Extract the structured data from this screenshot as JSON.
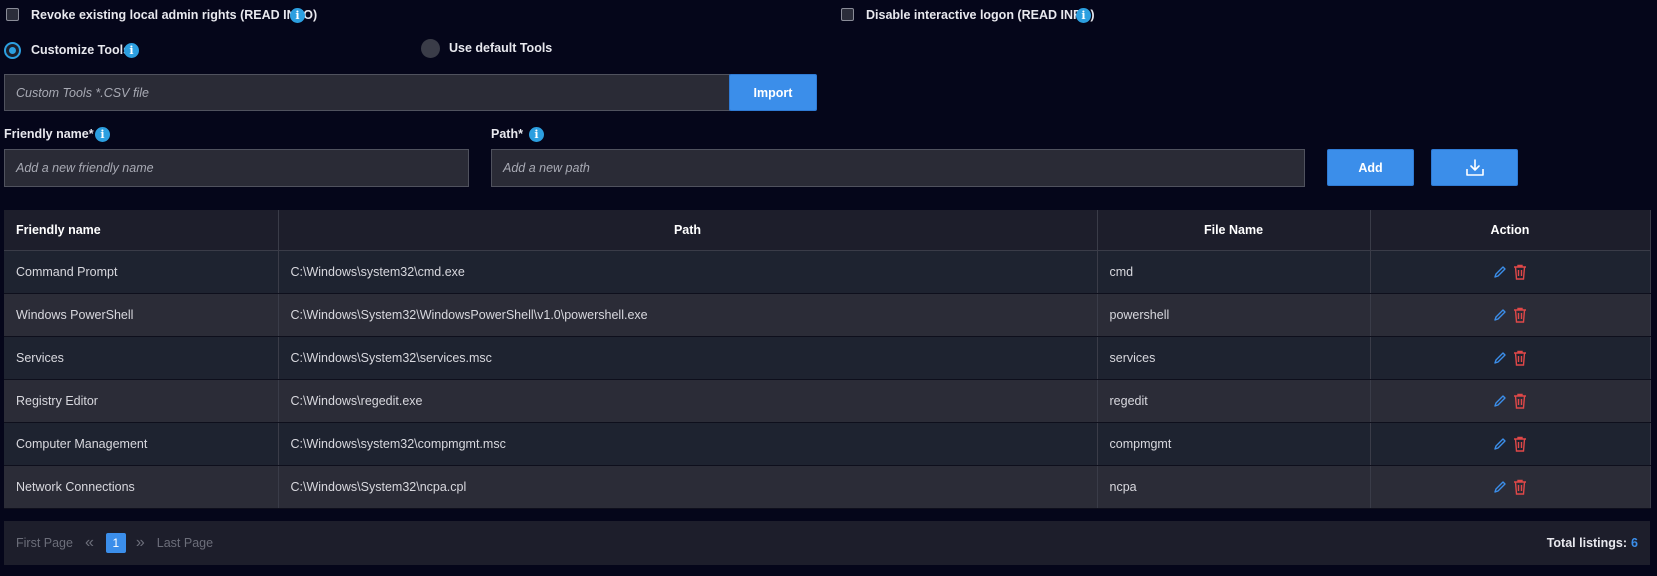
{
  "options": {
    "revoke_label": "Revoke existing local admin rights (READ INFO)",
    "disable_label": "Disable interactive logon (READ INFO)",
    "customize_label": "Customize Tools",
    "default_label": "Use default Tools"
  },
  "import": {
    "placeholder": "Custom Tools *.CSV file",
    "button_label": "Import"
  },
  "form": {
    "friendly_label": "Friendly name*",
    "friendly_placeholder": "Add a new friendly name",
    "path_label": "Path*",
    "path_placeholder": "Add a new path",
    "add_label": "Add",
    "download_icon": "download-icon"
  },
  "table": {
    "headers": [
      "Friendly name",
      "Path",
      "File Name",
      "Action"
    ],
    "rows": [
      {
        "name": "Command Prompt",
        "path": "C:\\Windows\\system32\\cmd.exe",
        "file": "cmd"
      },
      {
        "name": "Windows PowerShell",
        "path": "C:\\Windows\\System32\\WindowsPowerShell\\v1.0\\powershell.exe",
        "file": "powershell"
      },
      {
        "name": "Services",
        "path": "C:\\Windows\\System32\\services.msc",
        "file": "services"
      },
      {
        "name": "Registry Editor",
        "path": "C:\\Windows\\regedit.exe",
        "file": "regedit"
      },
      {
        "name": "Computer Management",
        "path": "C:\\Windows\\system32\\compmgmt.msc",
        "file": "compmgmt"
      },
      {
        "name": "Network Connections",
        "path": "C:\\Windows\\System32\\ncpa.cpl",
        "file": "ncpa"
      }
    ]
  },
  "pagination": {
    "first_label": "First Page",
    "current_page": "1",
    "last_label": "Last Page",
    "total_label": "Total listings:",
    "total_value": "6"
  },
  "colors": {
    "accent": "#3b8eea",
    "info": "#2c9fe0",
    "edit": "#3b8eea",
    "delete": "#e04848"
  }
}
